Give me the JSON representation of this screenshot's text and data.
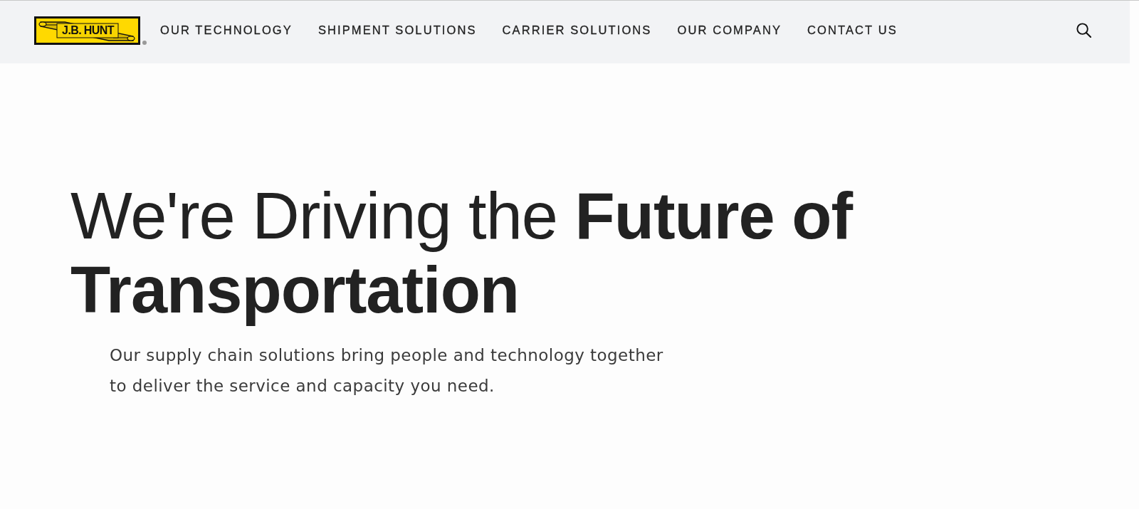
{
  "header": {
    "logo": {
      "text": "J.B. HUNT"
    },
    "nav": [
      "OUR TECHNOLOGY",
      "SHIPMENT SOLUTIONS",
      "CARRIER SOLUTIONS",
      "OUR COMPANY",
      "CONTACT US"
    ]
  },
  "hero": {
    "headline": "We're Driving the **Future of Transportation**",
    "subtitle": "Our supply chain solutions bring people and technology together to deliver the service and capacity you need."
  }
}
